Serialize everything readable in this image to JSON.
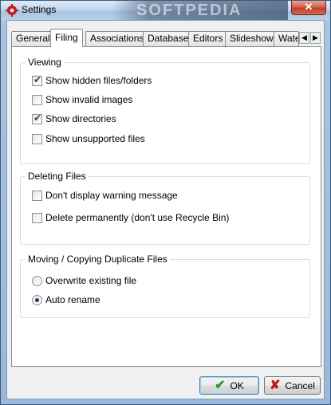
{
  "window": {
    "title": "Settings",
    "watermark": "SOFTPEDIA",
    "close_glyph": "✕"
  },
  "tabs": {
    "items": [
      {
        "label": "General"
      },
      {
        "label": "Filing"
      },
      {
        "label": "Associations"
      },
      {
        "label": "Database"
      },
      {
        "label": "Editors"
      },
      {
        "label": "Slideshow"
      },
      {
        "label": "Wate"
      }
    ],
    "active": "Filing",
    "scroll_left": "◀",
    "scroll_right": "▶"
  },
  "viewing": {
    "title": "Viewing",
    "options": [
      {
        "label": "Show hidden files/folders",
        "checked": true
      },
      {
        "label": "Show invalid images",
        "checked": false
      },
      {
        "label": "Show directories",
        "checked": true
      },
      {
        "label": "Show unsupported files",
        "checked": false
      }
    ]
  },
  "deleting": {
    "title": "Deleting Files",
    "options": [
      {
        "label": "Don't display warning message",
        "checked": false
      },
      {
        "label": "Delete permanently (don't use Recycle Bin)",
        "checked": false
      }
    ]
  },
  "duplicates": {
    "title": "Moving / Copying Duplicate Files",
    "options": [
      {
        "label": "Overwrite existing file",
        "selected": false
      },
      {
        "label": "Auto rename",
        "selected": true
      }
    ]
  },
  "buttons": {
    "ok_label": "OK",
    "ok_icon": "check-icon",
    "cancel_label": "Cancel",
    "cancel_icon": "x-icon"
  },
  "colors": {
    "ok_icon": "#2f9a2b",
    "cancel_icon": "#b81c1c"
  }
}
